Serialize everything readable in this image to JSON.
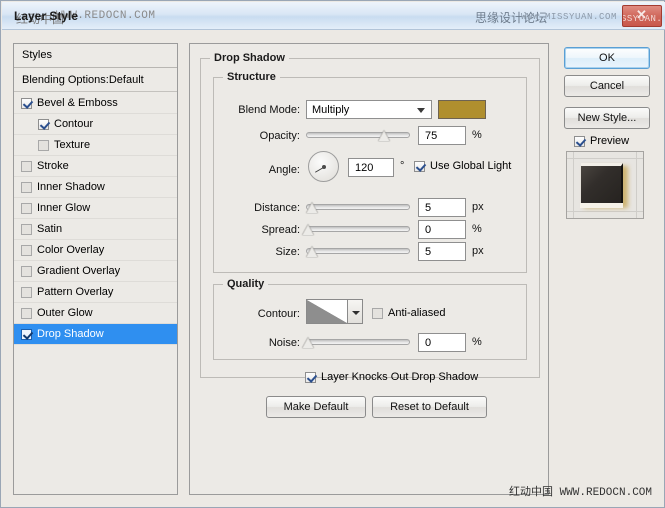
{
  "window": {
    "title": "Layer Style",
    "watermark_cn": "红动中国",
    "watermark_url": "WWW.REDOCN.COM",
    "titlebar_right_cn": "思缘设计论坛",
    "titlebar_right_url": "WWW.MISSYUAN.COM",
    "close_label": "✕",
    "close_overlay": "SSYUAN.COM"
  },
  "sidebar": {
    "header": "Styles",
    "blending_options": "Blending Options:Default",
    "items": [
      {
        "label": "Bevel & Emboss",
        "checked": true,
        "indent": false,
        "selected": false
      },
      {
        "label": "Contour",
        "checked": true,
        "indent": true,
        "selected": false
      },
      {
        "label": "Texture",
        "checked": false,
        "indent": true,
        "selected": false
      },
      {
        "label": "Stroke",
        "checked": false,
        "indent": false,
        "selected": false
      },
      {
        "label": "Inner Shadow",
        "checked": false,
        "indent": false,
        "selected": false
      },
      {
        "label": "Inner Glow",
        "checked": false,
        "indent": false,
        "selected": false
      },
      {
        "label": "Satin",
        "checked": false,
        "indent": false,
        "selected": false
      },
      {
        "label": "Color Overlay",
        "checked": false,
        "indent": false,
        "selected": false
      },
      {
        "label": "Gradient Overlay",
        "checked": false,
        "indent": false,
        "selected": false
      },
      {
        "label": "Pattern Overlay",
        "checked": false,
        "indent": false,
        "selected": false
      },
      {
        "label": "Outer Glow",
        "checked": false,
        "indent": false,
        "selected": false
      },
      {
        "label": "Drop Shadow",
        "checked": true,
        "indent": false,
        "selected": true
      }
    ]
  },
  "main": {
    "group_title": "Drop Shadow",
    "structure": {
      "legend": "Structure",
      "blend_mode_label": "Blend Mode:",
      "blend_mode_value": "Multiply",
      "shadow_color": "#b08f2e",
      "opacity_label": "Opacity:",
      "opacity_value": "75",
      "opacity_unit": "%",
      "angle_label": "Angle:",
      "angle_value": "120",
      "angle_unit": "°",
      "use_global_light": "Use Global Light",
      "use_global_light_checked": true,
      "distance_label": "Distance:",
      "distance_value": "5",
      "distance_unit": "px",
      "spread_label": "Spread:",
      "spread_value": "0",
      "spread_unit": "%",
      "size_label": "Size:",
      "size_value": "5",
      "size_unit": "px"
    },
    "quality": {
      "legend": "Quality",
      "contour_label": "Contour:",
      "anti_aliased": "Anti-aliased",
      "anti_aliased_checked": false,
      "noise_label": "Noise:",
      "noise_value": "0",
      "noise_unit": "%"
    },
    "knockout_label": "Layer Knocks Out Drop Shadow",
    "knockout_checked": true,
    "make_default": "Make Default",
    "reset_to_default": "Reset to Default"
  },
  "buttons": {
    "ok": "OK",
    "cancel": "Cancel",
    "new_style": "New Style...",
    "preview": "Preview",
    "preview_checked": true
  }
}
